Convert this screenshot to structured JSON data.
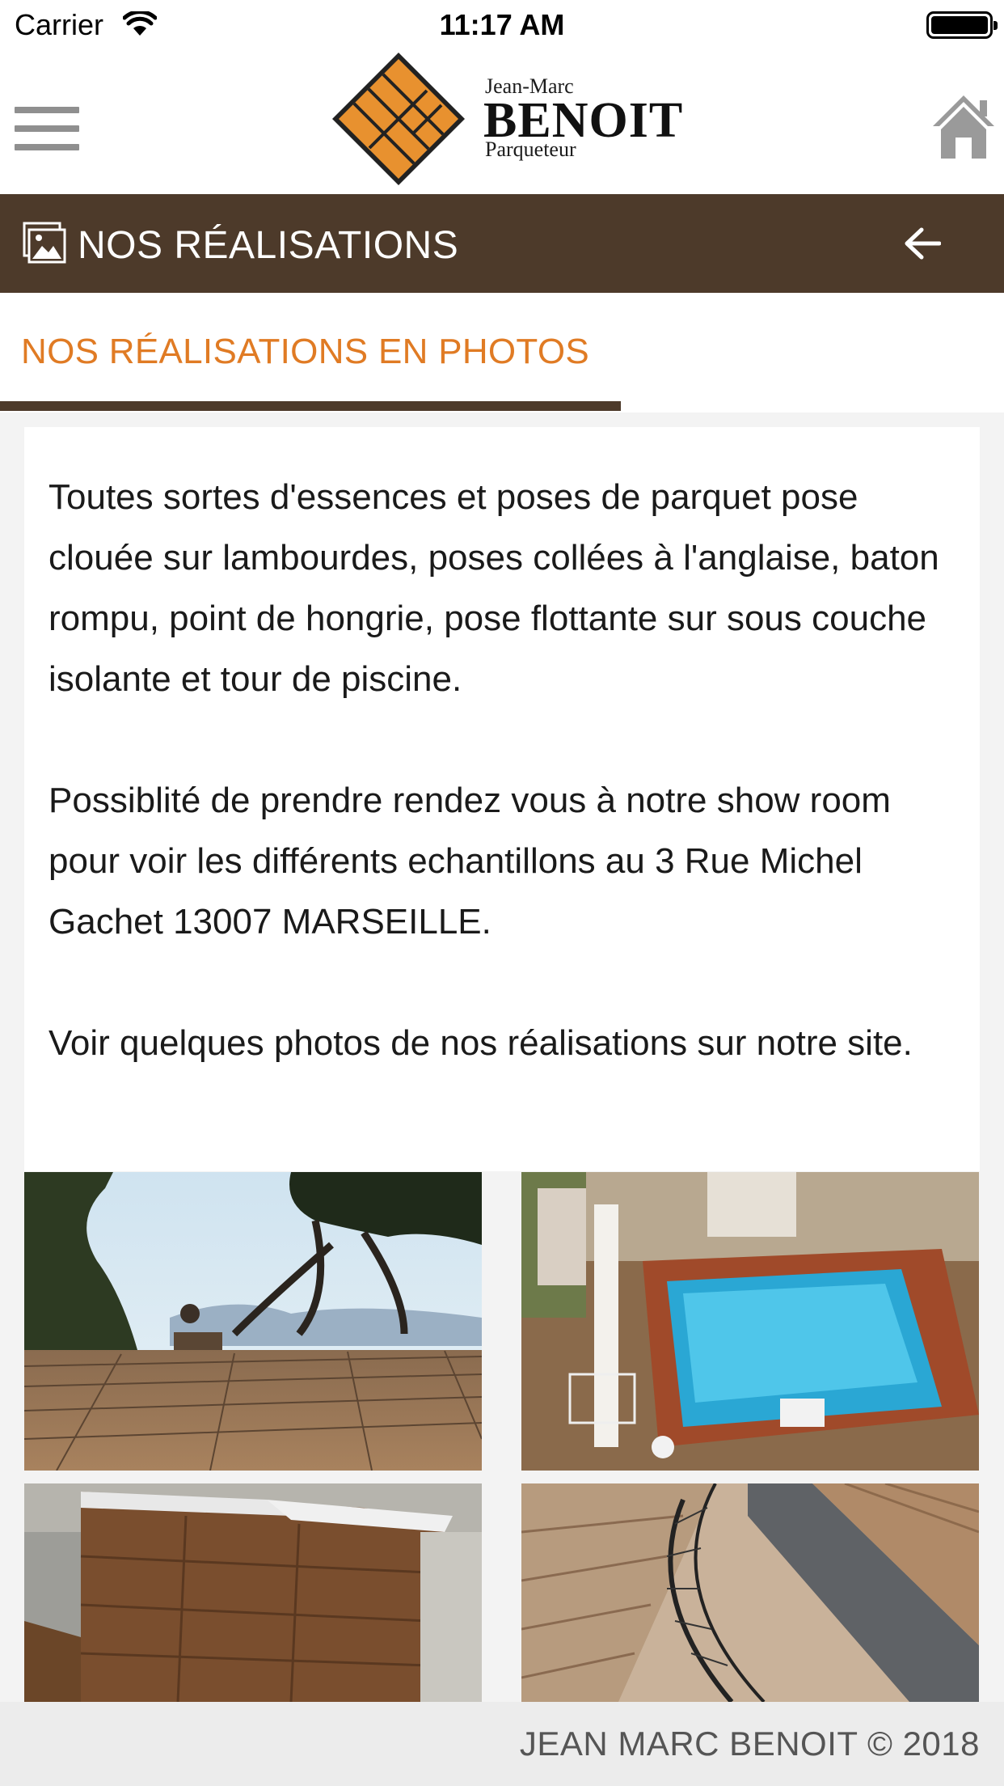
{
  "status_bar": {
    "carrier": "Carrier",
    "time": "11:17 AM"
  },
  "header": {
    "logo": {
      "small_line": "Jean-Marc",
      "name": "BENOIT",
      "subtitle": "Parqueteur"
    },
    "menu_icon": "hamburger-icon",
    "home_icon": "home-icon"
  },
  "title_bar": {
    "icon": "photos-icon",
    "title": "NOS RÉALISATIONS",
    "back_icon": "back-arrow-icon"
  },
  "tabs": [
    {
      "label": "NOS RÉALISATIONS EN PHOTOS",
      "active": true
    }
  ],
  "content": {
    "paragraphs": [
      "Toutes sortes d'essences et poses de parquet pose clouée sur lambourdes, poses collées à l'anglaise, baton rompu, point de hongrie, pose flottante sur sous couche isolante et tour de piscine.",
      "Possiblité de prendre rendez vous à notre show room pour voir les différents echantillons au 3 Rue Michel Gachet 13007 MARSEILLE.",
      "Voir quelques photos de nos réalisations sur notre site."
    ],
    "photos": [
      {
        "subject": "wooden deck overlooking the sea"
      },
      {
        "subject": "pool surrounded by wooden deck"
      },
      {
        "subject": "wood-panelled bathtub"
      },
      {
        "subject": "wooden spiral staircase"
      }
    ]
  },
  "colors": {
    "title_bar": "#4d3a2a",
    "accent_orange": "#e07b24",
    "footer_bg": "#ececec"
  },
  "footer": {
    "text": "JEAN MARC BENOIT © 2018"
  }
}
